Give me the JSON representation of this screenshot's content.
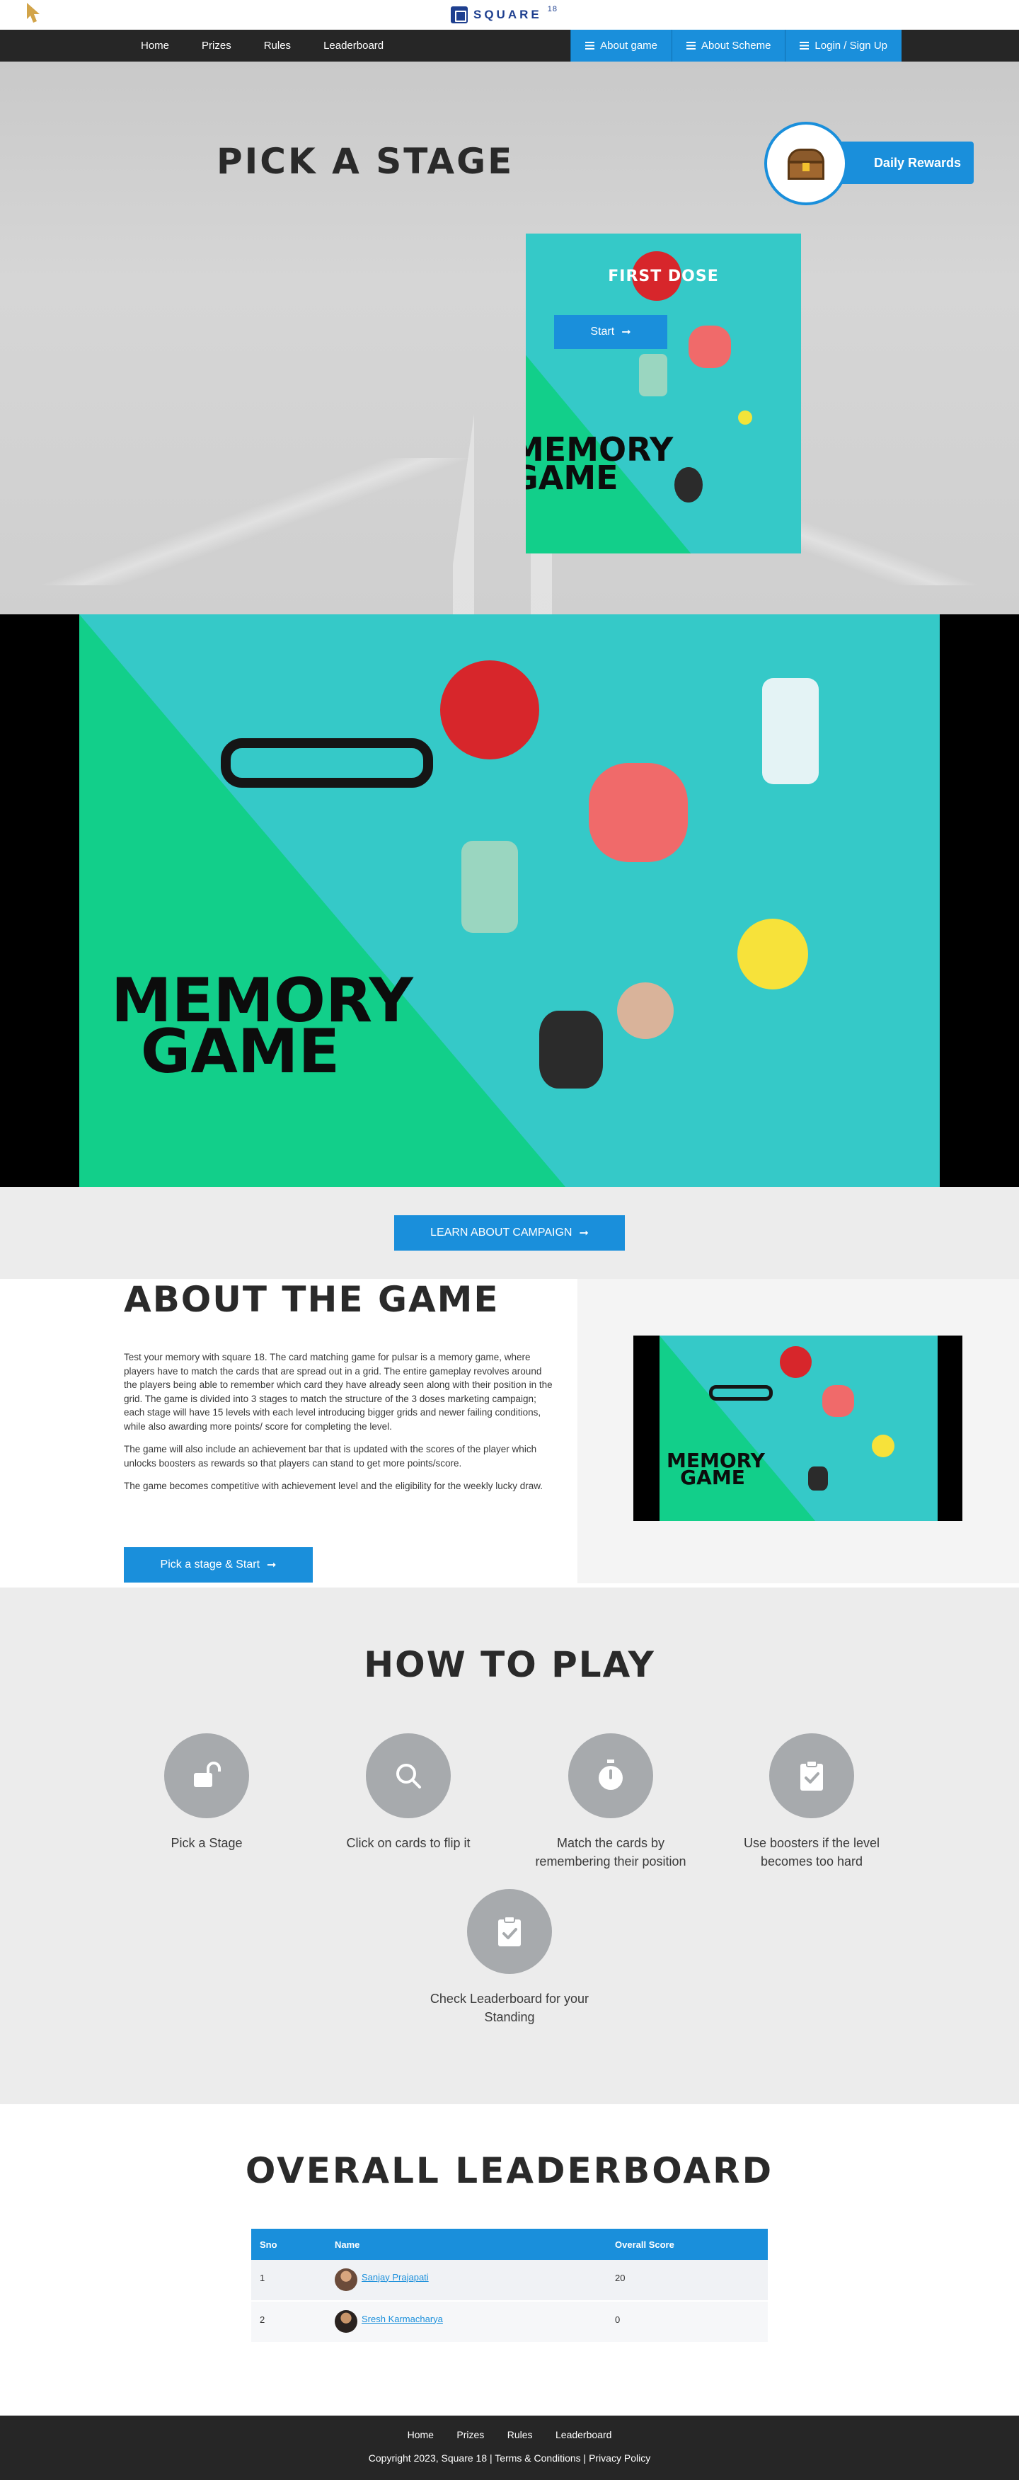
{
  "brand": {
    "name": "SQUARE",
    "superscript": "18"
  },
  "nav": {
    "links": [
      "Home",
      "Prizes",
      "Rules",
      "Leaderboard"
    ],
    "buttons": [
      "About game",
      "About Scheme",
      "Login / Sign Up"
    ]
  },
  "hero": {
    "title": "PICK A STAGE",
    "rewards_label": "Daily Rewards",
    "stage": {
      "title": "FIRST DOSE",
      "start_label": "Start",
      "art_text": [
        "MEMORY",
        "GAME"
      ]
    }
  },
  "banner": {
    "art_text": [
      "MEMORY",
      "GAME"
    ]
  },
  "campaign": {
    "button_label": "LEARN ABOUT CAMPAIGN"
  },
  "about": {
    "title": "ABOUT THE GAME",
    "paragraphs": [
      "Test your memory with square 18. The card matching game for pulsar is a memory game, where players have to match the cards that are spread out in a grid. The entire gameplay revolves around the players being able to remember which card they have already seen along with their position in the grid. The game is divided into 3 stages to match the structure of the 3 doses marketing campaign; each stage will have 15 levels with each level introducing bigger grids and newer failing conditions, while also awarding more points/ score for completing the level.",
      "The game will also include an achievement bar that is updated with the scores of the player which unlocks boosters as rewards so that players can stand to get more points/score.",
      "The game becomes competitive with achievement level and the eligibility for the weekly lucky draw."
    ],
    "cta_label": "Pick a stage & Start",
    "thumb_text": [
      "MEMORY",
      "GAME"
    ]
  },
  "howto": {
    "title": "HOW TO PLAY",
    "steps": [
      {
        "label": "Pick a Stage",
        "icon": "unlock-icon"
      },
      {
        "label": "Click on cards to flip it",
        "icon": "search-icon"
      },
      {
        "label": "Match the cards by remembering their position",
        "icon": "stopwatch-icon"
      },
      {
        "label": "Use boosters if the level becomes too hard",
        "icon": "clipboard-check-icon"
      },
      {
        "label": "Check Leaderboard for your Standing",
        "icon": "clipboard-check-icon"
      }
    ]
  },
  "leaderboard": {
    "title": "OVERALL LEADERBOARD",
    "columns": [
      "Sno",
      "Name",
      "Overall Score"
    ],
    "rows": [
      {
        "sno": "1",
        "name": "Sanjay Prajapati",
        "score": "20"
      },
      {
        "sno": "2",
        "name": "Sresh Karmacharya",
        "score": "0"
      }
    ]
  },
  "footer": {
    "links": [
      "Home",
      "Prizes",
      "Rules",
      "Leaderboard"
    ],
    "copyright": "Copyright 2023, Square 18 | Terms & Conditions | Privacy Policy"
  },
  "colors": {
    "accent": "#1a8fdb",
    "dark": "#262626",
    "teal": "#35c9c8",
    "green": "#12cf8a"
  }
}
